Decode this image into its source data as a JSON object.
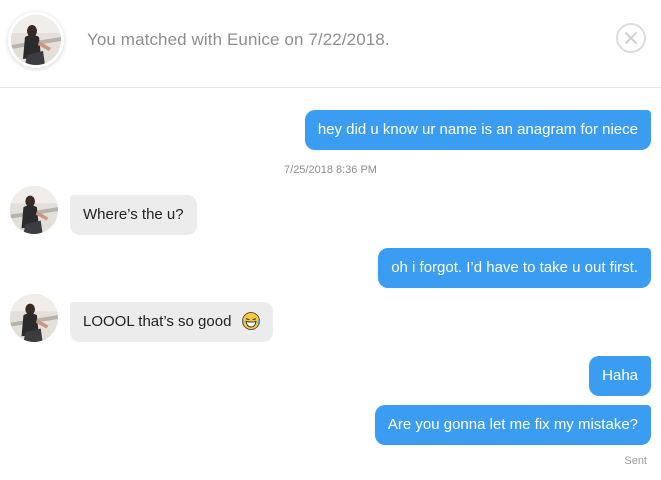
{
  "header": {
    "match_text": "You matched with Eunice on 7/22/2018.",
    "close_icon": "close-circle-icon"
  },
  "messages": [
    {
      "from": "me",
      "text": "hey did u know ur name is an anagram for niece"
    },
    {
      "timestamp": "7/25/2018 8:36 PM"
    },
    {
      "from": "Eunice",
      "text": "Where’s the u?"
    },
    {
      "from": "me",
      "text": "oh i forgot. I’d have to take u out first."
    },
    {
      "from": "Eunice",
      "text": "LOOOL that’s so good",
      "emoji": "laughing-emoji"
    },
    {
      "from": "me",
      "text": "Haha"
    },
    {
      "from": "me",
      "text": "Are you gonna let me fix my mistake?"
    }
  ],
  "status": "Sent",
  "colors": {
    "sent_bubble": "#3a9df1",
    "received_bubble": "#ececec",
    "muted_text": "#8e8e8e"
  }
}
